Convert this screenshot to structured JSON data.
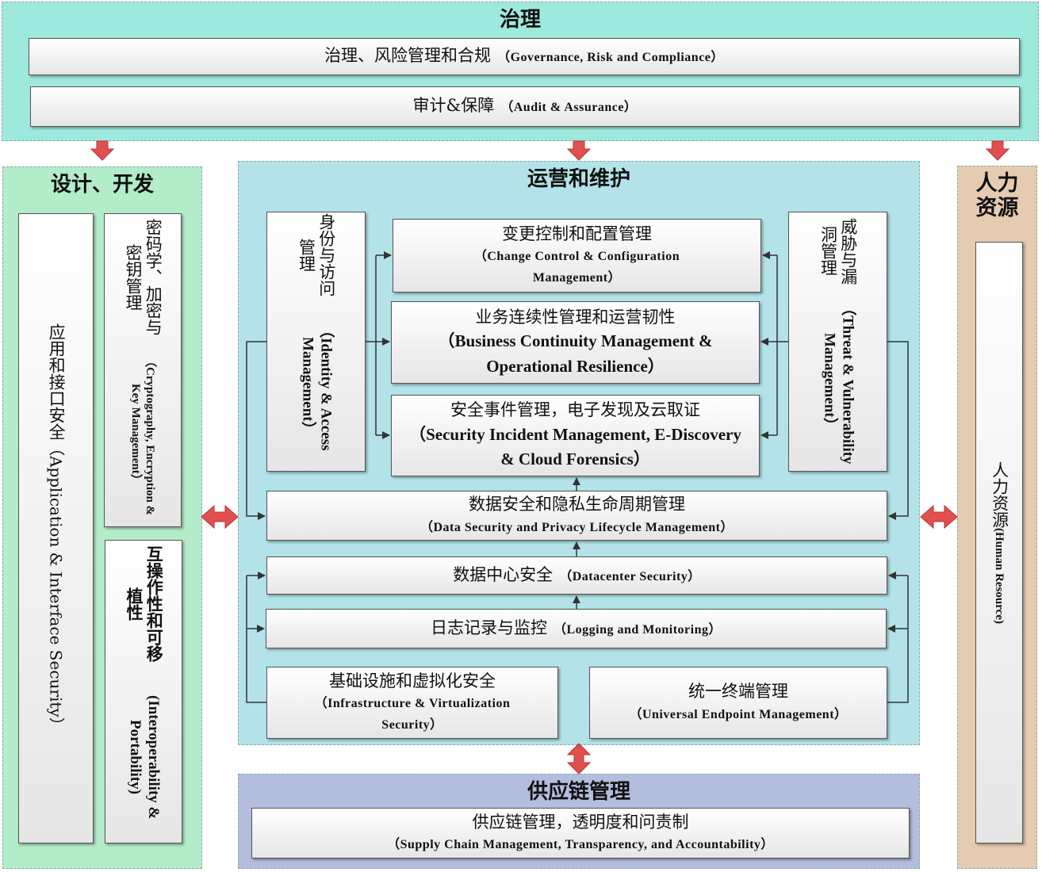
{
  "governance": {
    "title": "治理",
    "grc_cn": "治理、风险管理和合规",
    "grc_en": "（Governance, Risk and Compliance）",
    "audit_cn": "审计&保障",
    "audit_en": "（Audit & Assurance）"
  },
  "design": {
    "title": "设计、开发",
    "app_cn": "应用和接口安全",
    "app_en": "（Application & Interface Security）",
    "crypto_cn": "密码学、加密与密钥管理",
    "crypto_en": "（Cryptography, Encryption & Key Management）",
    "interop_cn": "互操作性和可移植性",
    "interop_en": "(Interoperability & Portability)"
  },
  "operations": {
    "title": "运营和维护",
    "iam_cn": "身份与访问管理",
    "iam_en": "（Identity & Access Management）",
    "ccm_cn": "变更控制和配置管理",
    "ccm_en": "（Change Control & Configuration Management）",
    "bcm_cn": "业务连续性管理和运营韧性",
    "bcm_en": "（Business Continuity Management & Operational Resilience）",
    "sim_cn": "安全事件管理，电子发现及云取证",
    "sim_en": "（Security Incident Management, E-Discovery & Cloud Forensics）",
    "tvm_cn": "威胁与漏洞管理",
    "tvm_en": "（Threat & Vulnerability Management）",
    "dsp_cn": "数据安全和隐私生命周期管理",
    "dsp_en": "（Data Security and Privacy Lifecycle Management）",
    "dc_cn": "数据中心安全",
    "dc_en": "（Datacenter Security）",
    "log_cn": "日志记录与监控",
    "log_en": "（Logging and Monitoring）",
    "ivs_cn": "基础设施和虚拟化安全",
    "ivs_en": "（Infrastructure & Virtualization Security）",
    "uem_cn": "统一终端管理",
    "uem_en": "（Universal Endpoint Management）"
  },
  "hr": {
    "title": "人力资源",
    "box_cn": "人力资源",
    "box_en": "(Human Resource)"
  },
  "supply": {
    "title": "供应链管理",
    "box_cn": "供应链管理，透明度和问责制",
    "box_en": "（Supply Chain Management, Transparency, and Accountability）"
  },
  "colors": {
    "governance_bg": "#9ee9de",
    "design_bg": "#b3ecc8",
    "operations_bg": "#b3e3e8",
    "hr_bg": "#e5cbb0",
    "supply_bg": "#b3bede",
    "arrow": "#e05050",
    "connector": "#333333"
  }
}
